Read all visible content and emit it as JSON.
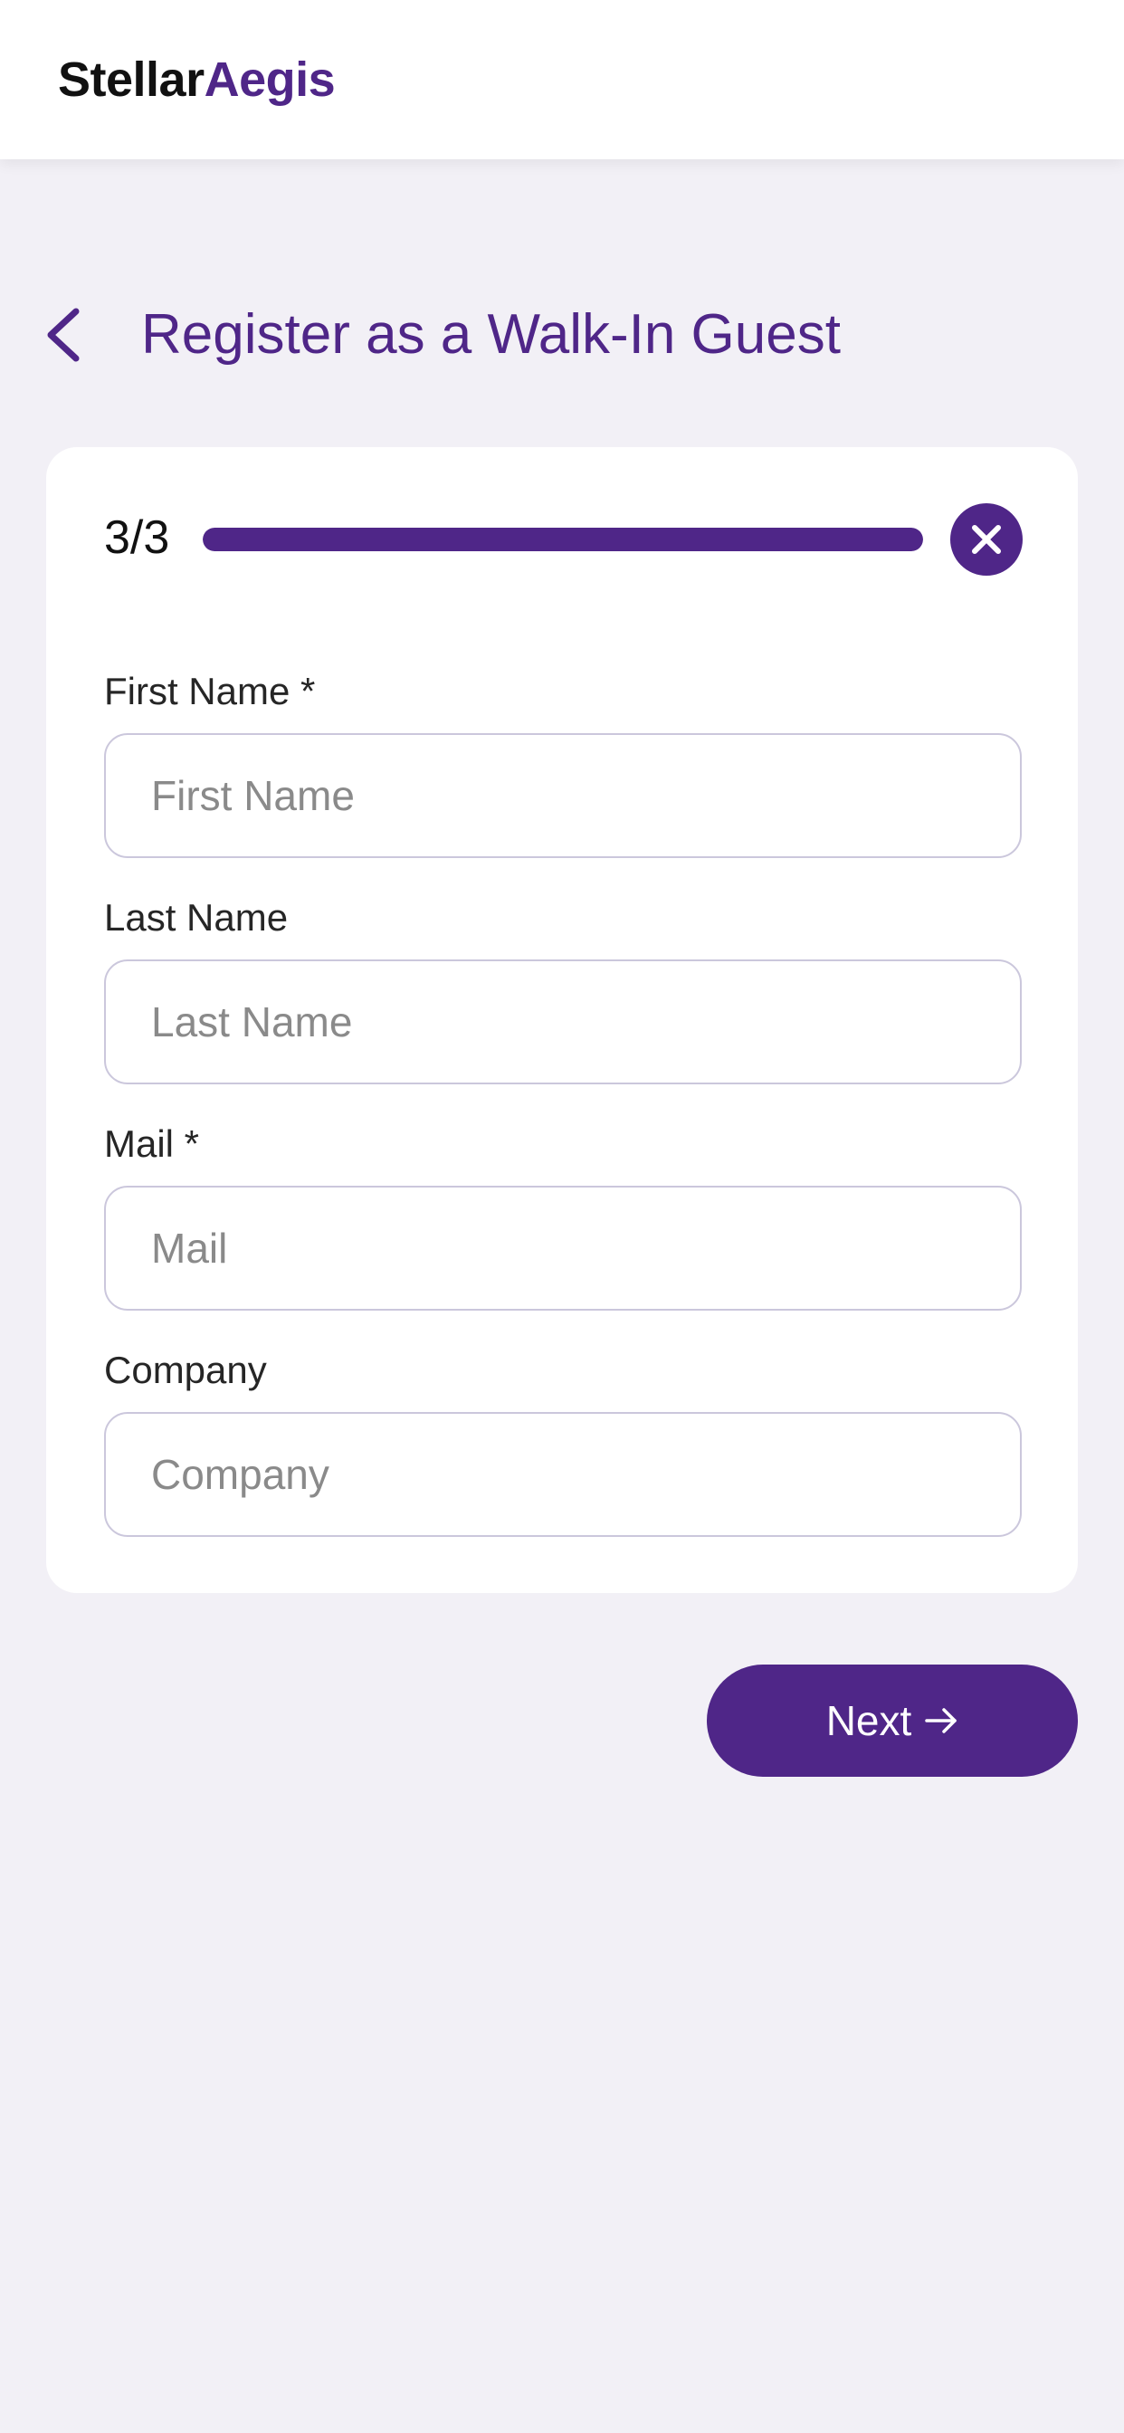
{
  "header": {
    "logo_part1": "Stellar",
    "logo_part2": "Aegis"
  },
  "page": {
    "title": "Register as a Walk-In Guest",
    "back_icon": "chevron-left-icon"
  },
  "progress": {
    "step_label": "3/3",
    "fraction": 1.0,
    "close_icon": "close-icon"
  },
  "form": {
    "fields": [
      {
        "label": "First Name *",
        "placeholder": "First Name",
        "value": ""
      },
      {
        "label": "Last Name",
        "placeholder": "Last Name",
        "value": ""
      },
      {
        "label": "Mail *",
        "placeholder": "Mail",
        "value": ""
      },
      {
        "label": "Company",
        "placeholder": "Company",
        "value": ""
      }
    ]
  },
  "actions": {
    "next_label": "Next",
    "next_icon": "arrow-right-icon"
  },
  "colors": {
    "brand": "#4f2688",
    "background": "#f2f0f6",
    "card": "#ffffff",
    "input_border": "#cbc7dc"
  }
}
